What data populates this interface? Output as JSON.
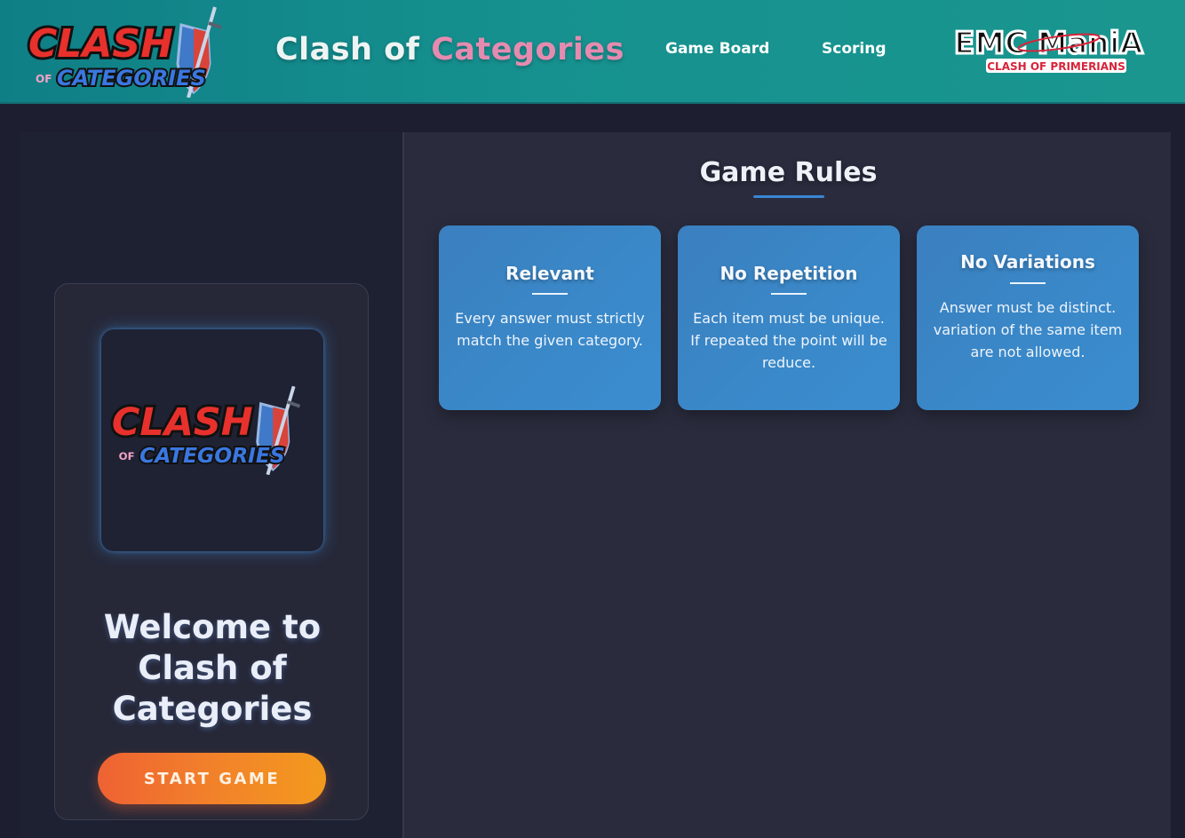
{
  "header": {
    "logo": {
      "line1": "CLASH",
      "of": "OF",
      "line2": "CATEGORIES"
    },
    "title_part1": "Clash of ",
    "title_part2": "Categories",
    "nav": [
      {
        "label": "Game Board"
      },
      {
        "label": "Scoring"
      }
    ],
    "partner_logo": {
      "name": "EMC ManiA",
      "tagline": "CLASH OF PRIMERIANS"
    }
  },
  "welcome": {
    "title": "Welcome to Clash of Categories",
    "start_button": "START GAME"
  },
  "rules": {
    "title": "Game Rules",
    "items": [
      {
        "name": "Relevant",
        "description": "Every answer must strictly match the given category."
      },
      {
        "name": "No Repetition",
        "description": "Each item must be unique. If repeated the point will be reduce."
      },
      {
        "name": "No Variations",
        "description": "Answer must be distinct. variation of the same item are not allowed."
      }
    ]
  },
  "colors": {
    "header_bg": "#16918f",
    "accent_pink": "#e58bb0",
    "card_blue": "#3a88c8",
    "button_orange": "#f2812a",
    "panel_bg": "#2a2c3e"
  }
}
